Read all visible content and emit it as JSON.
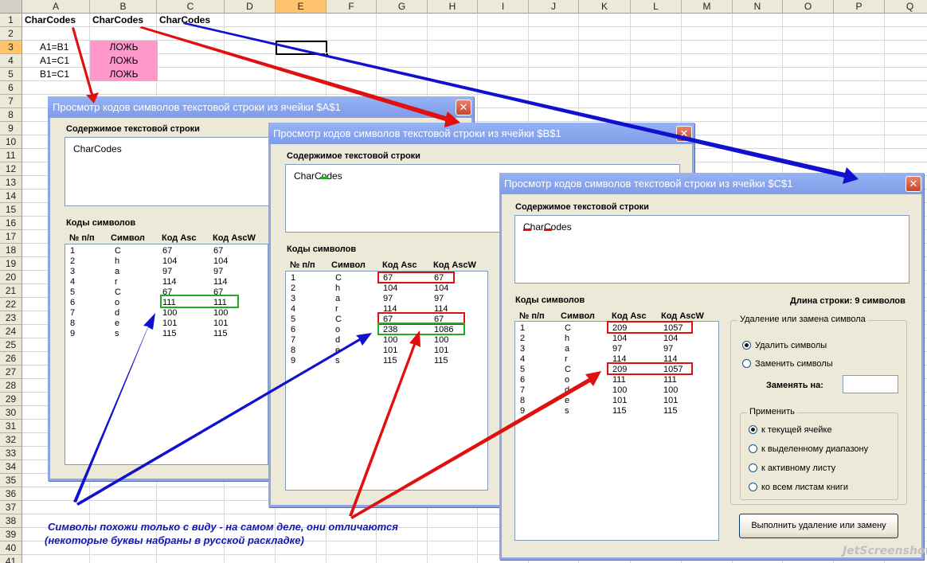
{
  "sheet": {
    "columns": [
      "A",
      "B",
      "C",
      "D",
      "E",
      "F",
      "G",
      "H",
      "I",
      "J",
      "K",
      "L",
      "M",
      "N",
      "O",
      "P",
      "Q"
    ],
    "rows": [
      "1",
      "2",
      "3",
      "4",
      "5",
      "6",
      "7",
      "8",
      "9",
      "10",
      "11",
      "12",
      "13",
      "14",
      "15",
      "16",
      "17",
      "18",
      "19",
      "20",
      "21",
      "22",
      "23",
      "24",
      "25",
      "26",
      "27",
      "28",
      "29",
      "30",
      "31",
      "32",
      "33",
      "34",
      "35",
      "36",
      "37",
      "38",
      "39",
      "40",
      "41"
    ],
    "cells": {
      "a1": "CharCodes",
      "b1": "CharCodes",
      "c1": "CharCodes",
      "a3": "A1=B1",
      "a4": "A1=C1",
      "a5": "B1=C1",
      "b3": "ЛОЖЬ",
      "b4": "ЛОЖЬ",
      "b5": "ЛОЖЬ"
    },
    "active_cell": "E3",
    "pink_color": "#ff99cc"
  },
  "dialog1": {
    "title": "Просмотр кодов символов текстовой строки из ячейки $A$1",
    "content_label": "Содержимое текстовой строки",
    "content_value": "CharCodes",
    "codes_label": "Коды символов",
    "headers": [
      "№ п/п",
      "Символ",
      "Код Asc",
      "Код AscW"
    ],
    "rows": [
      [
        "1",
        "C",
        "67",
        "67"
      ],
      [
        "2",
        "h",
        "104",
        "104"
      ],
      [
        "3",
        "a",
        "97",
        "97"
      ],
      [
        "4",
        "r",
        "114",
        "114"
      ],
      [
        "5",
        "C",
        "67",
        "67"
      ],
      [
        "6",
        "o",
        "111",
        "111"
      ],
      [
        "7",
        "d",
        "100",
        "100"
      ],
      [
        "8",
        "e",
        "101",
        "101"
      ],
      [
        "9",
        "s",
        "115",
        "115"
      ]
    ]
  },
  "dialog2": {
    "title": "Просмотр кодов символов текстовой строки из ячейки $B$1",
    "content_label": "Содержимое текстовой строки",
    "content_value": "CharCodes",
    "codes_label": "Коды символов",
    "headers": [
      "№ п/п",
      "Символ",
      "Код Asc",
      "Код AscW"
    ],
    "rows": [
      [
        "1",
        "C",
        "67",
        "67"
      ],
      [
        "2",
        "h",
        "104",
        "104"
      ],
      [
        "3",
        "a",
        "97",
        "97"
      ],
      [
        "4",
        "r",
        "114",
        "114"
      ],
      [
        "5",
        "C",
        "67",
        "67"
      ],
      [
        "6",
        "o",
        "238",
        "1086"
      ],
      [
        "7",
        "d",
        "100",
        "100"
      ],
      [
        "8",
        "e",
        "101",
        "101"
      ],
      [
        "9",
        "s",
        "115",
        "115"
      ]
    ]
  },
  "dialog3": {
    "title": "Просмотр кодов символов текстовой строки из ячейки $C$1",
    "content_label": "Содержимое текстовой строки",
    "content_value": "CharCodes",
    "codes_label": "Коды символов",
    "length_label": "Длина строки: 9 символов",
    "headers": [
      "№ п/п",
      "Символ",
      "Код Asc",
      "Код AscW"
    ],
    "rows": [
      [
        "1",
        "C",
        "209",
        "1057"
      ],
      [
        "2",
        "h",
        "104",
        "104"
      ],
      [
        "3",
        "a",
        "97",
        "97"
      ],
      [
        "4",
        "r",
        "114",
        "114"
      ],
      [
        "5",
        "C",
        "209",
        "1057"
      ],
      [
        "6",
        "o",
        "111",
        "111"
      ],
      [
        "7",
        "d",
        "100",
        "100"
      ],
      [
        "8",
        "e",
        "101",
        "101"
      ],
      [
        "9",
        "s",
        "115",
        "115"
      ]
    ],
    "group_delete": "Удаление или замена символа",
    "radio_delete": "Удалить символы",
    "radio_replace": "Заменить символы",
    "replace_with_label": "Заменять на:",
    "replace_with_value": "",
    "group_apply": "Применить",
    "apply_options": [
      "к текущей ячейке",
      "к выделенному диапазону",
      "к активному листу",
      "ко всем листам книги"
    ],
    "run_button": "Выполнить удаление или замену"
  },
  "annotation": {
    "line1": "Символы похожи только с виду - на самом деле, они отличаются",
    "line2": "(некоторые буквы набраны в русской раскладке)"
  },
  "watermark": "JetScreenshot",
  "colors": {
    "red": "#e01010",
    "blue": "#1010d0",
    "green": "#22aa22",
    "annotation": "#1515b0"
  }
}
